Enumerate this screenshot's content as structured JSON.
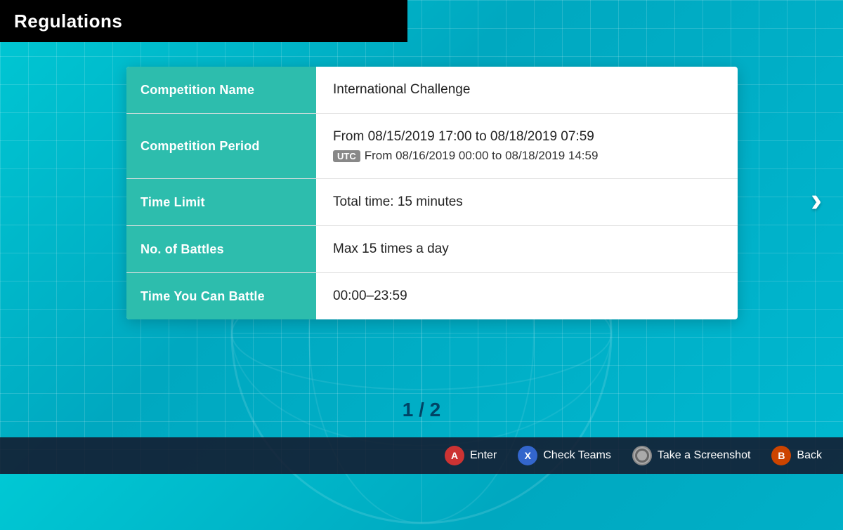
{
  "title": "Regulations",
  "page_indicator": "1 / 2",
  "table": {
    "rows": [
      {
        "label": "Competition Name",
        "value_primary": "International Challenge",
        "value_secondary": null,
        "utc": false
      },
      {
        "label": "Competition Period",
        "value_primary": "From 08/15/2019 17:00    to  08/18/2019 07:59",
        "value_secondary": "From 08/16/2019 00:00    to  08/18/2019 14:59",
        "utc": true
      },
      {
        "label": "Time Limit",
        "value_primary": "Total time: 15 minutes",
        "value_secondary": null,
        "utc": false
      },
      {
        "label": "No. of Battles",
        "value_primary": "Max 15 times a day",
        "value_secondary": null,
        "utc": false
      },
      {
        "label": "Time You Can Battle",
        "value_primary": "00:00–23:59",
        "value_secondary": null,
        "utc": false
      }
    ]
  },
  "nav_arrow": "›",
  "bottom_bar": {
    "actions": [
      {
        "btn": "A",
        "label": "Enter",
        "color": "btn-a"
      },
      {
        "btn": "X",
        "label": "Check Teams",
        "color": "btn-x"
      },
      {
        "btn": "O",
        "label": "Take a Screenshot",
        "color": "btn-o"
      },
      {
        "btn": "B",
        "label": "Back",
        "color": "btn-b"
      }
    ]
  },
  "utc_badge_label": "UTC"
}
